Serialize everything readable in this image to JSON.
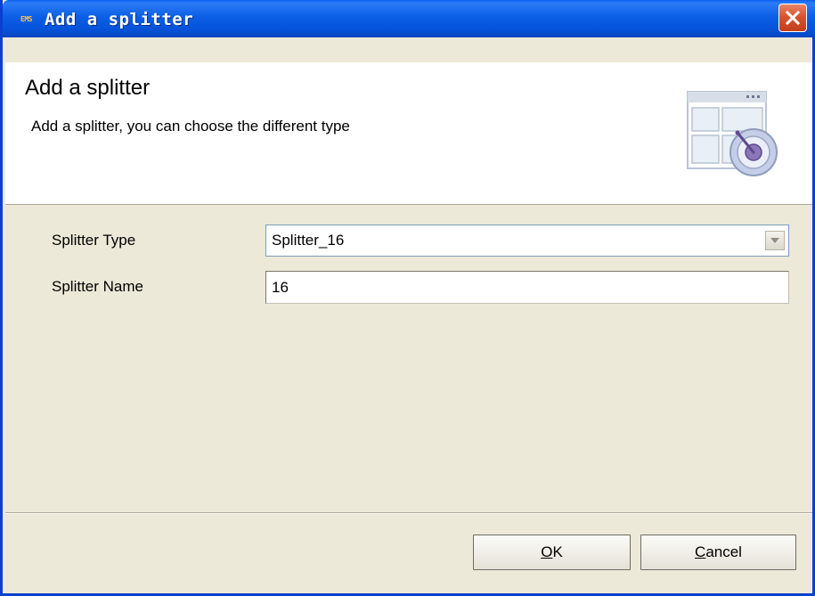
{
  "window": {
    "app_icon_text": "EMS",
    "title": "Add a splitter"
  },
  "header": {
    "title": "Add a splitter",
    "description": "Add a splitter, you can choose the different type",
    "icon": "window-layout-dial-icon"
  },
  "form": {
    "splitter_type": {
      "label": "Splitter Type",
      "value": "Splitter_16"
    },
    "splitter_name": {
      "label": "Splitter Name",
      "value": "16"
    }
  },
  "buttons": {
    "ok": {
      "mnemonic": "O",
      "rest": "K"
    },
    "cancel": {
      "mnemonic": "C",
      "rest": "ancel"
    }
  },
  "colors": {
    "titlebar": "#0552d8",
    "close_button": "#d8542e",
    "dialog_background": "#ece9d8"
  }
}
